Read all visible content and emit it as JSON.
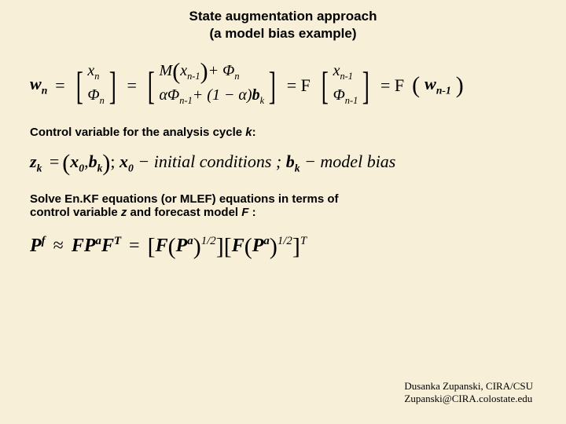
{
  "title_l1": "State augmentation approach",
  "title_l2": "(a model bias example)",
  "eq1": {
    "w": "w",
    "wn": "n",
    "eq": "=",
    "m11": "x",
    "m11s": "n",
    "m21": "Φ",
    "m21s": "n",
    "r11a": "M",
    "r11b": "x",
    "r11bs": "n-1",
    "r11c": "+ Φ",
    "r11cs": "n",
    "r21a": "αΦ",
    "r21as": "n-1",
    "r21b": "+ (1 − α)",
    "r21c": "b",
    "r21cs": "k",
    "Feq": "= F",
    "c11": "x",
    "c11s": "n-1",
    "c21": "Φ",
    "c21s": "n-1",
    "tail": "= F",
    "tailp": "w",
    "tailps": "n-1"
  },
  "label1a": "Control variable for the analysis cycle ",
  "label1b": "k",
  "label1c": ":",
  "eq2": {
    "z": "z",
    "zk": "k",
    "eq": "=",
    "x0": "x",
    "x0s": "0",
    "comma": ",",
    "bk": "b",
    "bks": "k",
    "sep1": ";  ",
    "x0l": "x",
    "x0ls": "0",
    "txt1": " − initial  conditions ;  ",
    "bkl": "b",
    "bkls": "k",
    "txt2": " − model  bias"
  },
  "label2a": "Solve En.KF equations (or MLEF) equations in terms of",
  "label2b": "control variable ",
  "label2c": "z",
  "label2d": " and forecast model ",
  "label2e": "F",
  "label2f": " :",
  "eq3": {
    "P": "P",
    "f": "f",
    "approx": "≈",
    "F1": "F",
    "Pa": "P",
    "a1": "a",
    "FT": "F",
    "T": "T",
    "eq": "=",
    "half": "1/2",
    "F2": "F",
    "Pa2": "P",
    "a2": "a",
    "F3": "F",
    "Pa3": "P",
    "a3": "a"
  },
  "footer_l1": "Dusanka Zupanski,  CIRA/CSU",
  "footer_l2": "Zupanski@CIRA.colostate.edu"
}
